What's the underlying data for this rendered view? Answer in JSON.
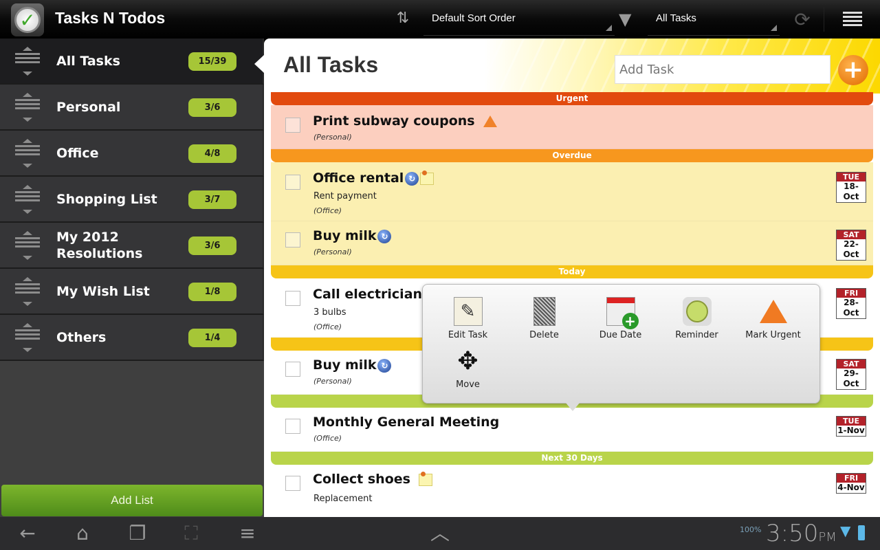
{
  "app": {
    "title": "Tasks N Todos",
    "icon": "clock-check-icon"
  },
  "toolbar": {
    "sort_icon": "sort-arrows-icon",
    "sort_value": "Default Sort Order",
    "filter_icon": "filter-funnel-icon",
    "filter_value": "All Tasks",
    "refresh_icon": "refresh-icon",
    "menu_icon": "overflow-menu-icon"
  },
  "sidebar": {
    "items": [
      {
        "label": "All Tasks",
        "count": "15/39",
        "active": true
      },
      {
        "label": "Personal",
        "count": "3/6"
      },
      {
        "label": "Office",
        "count": "4/8"
      },
      {
        "label": "Shopping List",
        "count": "3/7"
      },
      {
        "label": "My 2012 Resolutions",
        "count": "3/6"
      },
      {
        "label": "My Wish List",
        "count": "1/8"
      },
      {
        "label": "Others",
        "count": "1/4"
      }
    ],
    "add_list_label": "Add List"
  },
  "main": {
    "title": "All Tasks",
    "add_task_placeholder": "Add Task",
    "add_button_icon": "plus-icon",
    "sections": {
      "urgent": {
        "label": "Urgent",
        "color": "#e24a0e"
      },
      "overdue": {
        "label": "Overdue",
        "color": "#f7971e"
      },
      "today": {
        "label": "Today",
        "color": "#f6c417"
      },
      "next30": {
        "label": "Next 30 Days",
        "color": "#b9d44a"
      }
    },
    "tasks": [
      {
        "title": "Print subway coupons",
        "category": "(Personal)",
        "icons": [
          "warning-icon"
        ]
      },
      {
        "title": "Office rental",
        "note": "Rent payment",
        "category": "(Office)",
        "icons": [
          "repeat-icon",
          "note-icon"
        ],
        "due_day": "TUE",
        "due_date": "18-Oct"
      },
      {
        "title": "Buy milk",
        "category": "(Personal)",
        "icons": [
          "repeat-icon"
        ],
        "due_day": "SAT",
        "due_date": "22-Oct"
      },
      {
        "title": "Call electrician",
        "note": "3 bulbs",
        "category": "(Office)",
        "icons": [
          "note-icon"
        ],
        "due_day": "FRI",
        "due_date": "28-Oct"
      },
      {
        "title": "Buy milk",
        "category": "(Personal)",
        "icons": [
          "repeat-icon"
        ],
        "due_day": "SAT",
        "due_date": "29-Oct"
      },
      {
        "title": "Monthly General Meeting",
        "category": "(Office)",
        "due_day": "TUE",
        "due_date": "1-Nov"
      },
      {
        "title": "Collect shoes",
        "note": "Replacement",
        "icons": [
          "note-icon"
        ],
        "due_day": "FRI",
        "due_date": "4-Nov"
      }
    ]
  },
  "context_menu": {
    "items": [
      {
        "label": "Edit Task",
        "icon": "notepad-pen-icon"
      },
      {
        "label": "Delete",
        "icon": "trash-icon"
      },
      {
        "label": "Due Date",
        "icon": "calendar-add-icon"
      },
      {
        "label": "Reminder",
        "icon": "alarm-clock-icon"
      },
      {
        "label": "Mark Urgent",
        "icon": "warning-icon"
      },
      {
        "label": "Move",
        "icon": "move-arrows-icon"
      }
    ]
  },
  "system_bar": {
    "time": "3:50",
    "ampm": "PM",
    "battery_badge": "100%"
  }
}
